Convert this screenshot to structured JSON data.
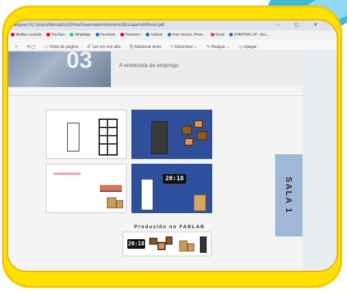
{
  "browser": {
    "url": "arquivo:///C:/Users/Renata%20Pinto/Downloads/Historia%20Escape%20Room.pdf",
    "window_controls": "– ◻ ✕",
    "bookmarks": [
      {
        "label": "McAfee LiveSafe",
        "color": "#c8102e"
      },
      {
        "label": "YouTube",
        "color": "#ff0000"
      },
      {
        "label": "WhatsApp",
        "color": "#25d366"
      },
      {
        "label": "Facebook",
        "color": "#1877f2"
      },
      {
        "label": "Pinterest •",
        "color": "#e60023"
      },
      {
        "label": "Outlook",
        "color": "#0078d4"
      },
      {
        "label": "Free Vectors, Photo...",
        "color": "#1273eb"
      },
      {
        "label": "Gmail",
        "color": "#ea4335"
      },
      {
        "label": "STARTING UP – Acc...",
        "color": "#2b6cb0"
      }
    ],
    "toolbar": {
      "add": "+",
      "page_view": "Vista de página",
      "read_aloud": "Ler em voz alta",
      "add_text": "Adicionar texto",
      "draw": "Desenhar",
      "highlight": "Realçar",
      "erase": "Apagar"
    }
  },
  "document": {
    "chapter_number": "03",
    "subtitle": "A entrevista de emprego",
    "side_label": "SALA 1",
    "caption": "Produzido no FABLAB",
    "clock_text": "20:18"
  },
  "colors": {
    "frame": "#ffe000",
    "tile_blue": "#2d4f9c",
    "sidebar": "#9fb8d6"
  }
}
